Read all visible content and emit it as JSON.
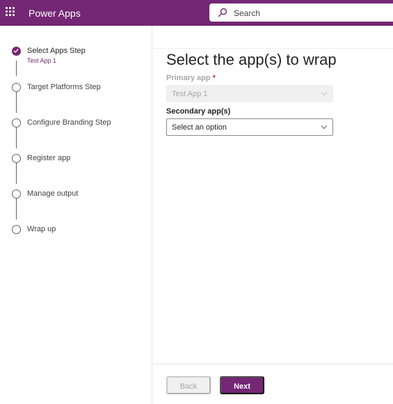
{
  "header": {
    "app_name": "Power Apps",
    "search": {
      "placeholder": "Search"
    }
  },
  "colors": {
    "brand": "#742774",
    "required": "#c4314b"
  },
  "wizard": {
    "steps": [
      {
        "label": "Select Apps Step",
        "sublabel": "Test App 1",
        "state": "current-complete"
      },
      {
        "label": "Target Platforms Step",
        "state": "pending"
      },
      {
        "label": "Configure Branding Step",
        "state": "pending"
      },
      {
        "label": "Register app",
        "state": "pending"
      },
      {
        "label": "Manage output",
        "state": "pending"
      },
      {
        "label": "Wrap up",
        "state": "pending"
      }
    ]
  },
  "main": {
    "title": "Select the app(s) to wrap",
    "primary": {
      "label": "Primary app",
      "required_marker": "*",
      "value": "Test App 1"
    },
    "secondary": {
      "label": "Secondary app(s)",
      "placeholder": "Select an option"
    }
  },
  "footer": {
    "back_label": "Back",
    "next_label": "Next"
  }
}
